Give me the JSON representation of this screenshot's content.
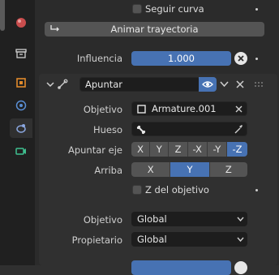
{
  "top": {
    "follow_curve_label": "Seguir curva",
    "animate_path_label": "Animar trayectoria",
    "influence_label": "Influencia",
    "influence_value": "1.000",
    "influence_fraction": 1.0
  },
  "constraint": {
    "name": "Apuntar",
    "target_label": "Objetivo",
    "target_value": "Armature.001",
    "bone_label": "Hueso",
    "bone_value": "",
    "track_axis_label": "Apuntar eje",
    "track_axis_options": [
      "X",
      "Y",
      "Z",
      "-X",
      "-Y",
      "-Z"
    ],
    "track_axis_selected": "-Z",
    "up_label": "Arriba",
    "up_options": [
      "X",
      "Y",
      "Z"
    ],
    "up_selected": "Y",
    "target_z_label": "Z del objetivo",
    "target_space_label": "Objetivo",
    "target_space_value": "Global",
    "owner_space_label": "Propietario",
    "owner_space_value": "Global"
  },
  "colors": {
    "accent": "#4772b3",
    "panel": "#2b2b2b",
    "field": "#1d1d1d"
  },
  "icons": {
    "tabs": [
      "sphere-material-icon",
      "scene-icon",
      "world-icon",
      "object-icon",
      "modifier-icon",
      "physics-icon",
      "constraint-icon",
      "data-icon"
    ]
  }
}
